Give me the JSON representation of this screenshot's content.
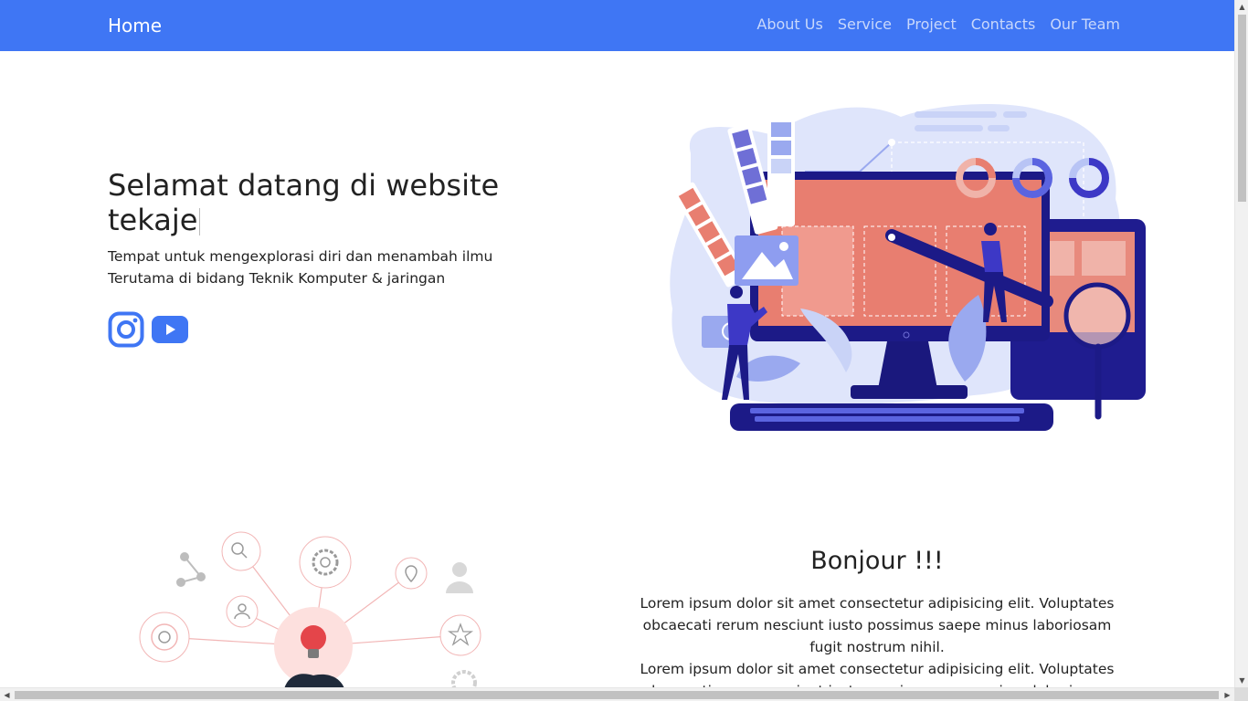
{
  "navbar": {
    "brand": "Home",
    "links": [
      "About Us",
      "Service",
      "Project",
      "Contacts",
      "Our Team"
    ],
    "color": "#3f76f4"
  },
  "hero": {
    "title": "Selamat datang di website tekaje",
    "subtitle_line1": "Tempat untuk mengexplorasi diri dan menambah ilmu",
    "subtitle_line2": "Terutama di bidang Teknik Komputer & jaringan",
    "social_icons": [
      "instagram-icon",
      "youtube-icon"
    ],
    "icon_color": "#3f76f4"
  },
  "about": {
    "heading": "Bonjour !!!",
    "paragraph1": "Lorem ipsum dolor sit amet consectetur adipisicing elit. Voluptates obcaecati rerum nesciunt iusto possimus saepe minus laboriosam fugit nostrum nihil.",
    "paragraph2": "Lorem ipsum dolor sit amet consectetur adipisicing elit. Voluptates obcaecati rerum nesciunt iusto possimus saepe minus laboriosam"
  },
  "scrollbars": {
    "up_arrow": "▲",
    "down_arrow": "▼",
    "left_arrow": "◀",
    "right_arrow": "▶"
  }
}
